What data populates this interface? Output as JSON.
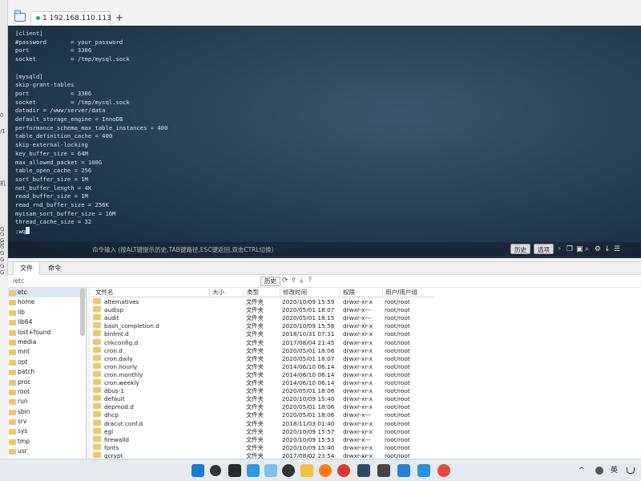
{
  "left_strip": {
    "fragments": [
      "0",
      "/1",
      "机",
      "G",
      "G",
      "G",
      "G",
      "G",
      "G",
      "G",
      "G",
      "G"
    ]
  },
  "tabbar": {
    "session_tab_label": "1 192.168.110.113",
    "add_tab_label": "+"
  },
  "terminal": {
    "lines": [
      "[client]",
      "#password       = your_password",
      "port            = 3306",
      "socket          = /tmp/mysql.sock",
      "",
      "[mysqld]",
      "skip-grant-tables",
      "port            = 3306",
      "socket          = /tmp/mysql.sock",
      "datadir = /www/server/data",
      "default_storage_engine = InnoDB",
      "performance_schema_max_table_instances = 400",
      "table_definition_cache = 400",
      "skip-external-locking",
      "key_buffer_size = 64M",
      "max_allowed_packet = 100G",
      "table_open_cache = 256",
      "sort_buffer_size = 1M",
      "net_buffer_length = 4K",
      "read_buffer_size = 1M",
      "read_rnd_buffer_size = 256K",
      "myisam_sort_buffer_size = 16M",
      "thread_cache_size = 32"
    ],
    "prompt": ":wq"
  },
  "command_bar": {
    "hint": "命令输入 (按ALT键提示历史,TAB键路径,ESC键返回,双击CTRL切换)",
    "history_button": "历史",
    "options_button": "选项"
  },
  "bottom_tabs": {
    "files_tab": "文件",
    "commands_tab": "命令"
  },
  "pathbar": {
    "path": "/etc",
    "history_button": "历史"
  },
  "tree": {
    "items": [
      "etc",
      "home",
      "lib",
      "lib64",
      "lost+found",
      "media",
      "mnt",
      "opt",
      "patch",
      "proc",
      "root",
      "run",
      "sbin",
      "srv",
      "sys",
      "tmp",
      "usr"
    ],
    "selected": "etc"
  },
  "file_list": {
    "columns": {
      "name": "文件名",
      "size": "大小",
      "type": "类型",
      "mtime": "修改时间",
      "perm": "权限",
      "owner": "用户/用户组"
    },
    "rows": [
      {
        "name": "alternatives",
        "type": "文件夹",
        "mtime": "2020/10/09 15:59",
        "perm": "drwxr-xr-x",
        "owner": "root/root"
      },
      {
        "name": "audisp",
        "type": "文件夹",
        "mtime": "2020/05/01 18:07",
        "perm": "drwxr-x---",
        "owner": "root/root"
      },
      {
        "name": "audit",
        "type": "文件夹",
        "mtime": "2020/05/01 18:15",
        "perm": "drwxr-x---",
        "owner": "root/root"
      },
      {
        "name": "bash_completion.d",
        "type": "文件夹",
        "mtime": "2020/10/09 15:58",
        "perm": "drwxr-xr-x",
        "owner": "root/root"
      },
      {
        "name": "binfmt.d",
        "type": "文件夹",
        "mtime": "2018/10/31 07:31",
        "perm": "drwxr-xr-x",
        "owner": "root/root"
      },
      {
        "name": "chkconfig.d",
        "type": "文件夹",
        "mtime": "2017/08/04 21:45",
        "perm": "drwxr-xr-x",
        "owner": "root/root"
      },
      {
        "name": "cron.d",
        "type": "文件夹",
        "mtime": "2020/05/01 18:06",
        "perm": "drwxr-xr-x",
        "owner": "root/root"
      },
      {
        "name": "cron.daily",
        "type": "文件夹",
        "mtime": "2020/05/01 18:07",
        "perm": "drwxr-xr-x",
        "owner": "root/root"
      },
      {
        "name": "cron.hourly",
        "type": "文件夹",
        "mtime": "2014/06/10 06:14",
        "perm": "drwxr-xr-x",
        "owner": "root/root"
      },
      {
        "name": "cron.monthly",
        "type": "文件夹",
        "mtime": "2014/06/10 06:14",
        "perm": "drwxr-xr-x",
        "owner": "root/root"
      },
      {
        "name": "cron.weekly",
        "type": "文件夹",
        "mtime": "2014/06/10 06:14",
        "perm": "drwxr-xr-x",
        "owner": "root/root"
      },
      {
        "name": "dbus-1",
        "type": "文件夹",
        "mtime": "2020/05/01 18:06",
        "perm": "drwxr-xr-x",
        "owner": "root/root"
      },
      {
        "name": "default",
        "type": "文件夹",
        "mtime": "2020/10/09 15:40",
        "perm": "drwxr-xr-x",
        "owner": "root/root"
      },
      {
        "name": "depmod.d",
        "type": "文件夹",
        "mtime": "2020/05/01 18:06",
        "perm": "drwxr-xr-x",
        "owner": "root/root"
      },
      {
        "name": "dhcp",
        "type": "文件夹",
        "mtime": "2020/05/01 18:06",
        "perm": "drwxr-x---",
        "owner": "root/root"
      },
      {
        "name": "dracut.conf.d",
        "type": "文件夹",
        "mtime": "2018/11/03 01:40",
        "perm": "drwxr-xr-x",
        "owner": "root/root"
      },
      {
        "name": "egl",
        "type": "文件夹",
        "mtime": "2020/10/09 15:57",
        "perm": "drwxr-xr-x",
        "owner": "root/root"
      },
      {
        "name": "firewalld",
        "type": "文件夹",
        "mtime": "2020/10/09 15:53",
        "perm": "drwxr-x---",
        "owner": "root/root"
      },
      {
        "name": "fonts",
        "type": "文件夹",
        "mtime": "2020/10/09 15:40",
        "perm": "drwxr-xr-x",
        "owner": "root/root"
      },
      {
        "name": "gcrypt",
        "type": "文件夹",
        "mtime": "2017/08/02 23:54",
        "perm": "drwxr-xr-x",
        "owner": "root/root"
      }
    ]
  },
  "taskbar": {
    "icons": [
      "windows-start",
      "search",
      "task-view",
      "file-explorer",
      "firefox",
      "browser",
      "terminal-app",
      "app",
      "vscode",
      "chat",
      "app-2"
    ],
    "tray_arrow": "^",
    "ime": "英"
  },
  "colors": {
    "terminal_bg": "#2c465c",
    "accent": "#3a7bd5",
    "folder": "#f2c46b"
  }
}
